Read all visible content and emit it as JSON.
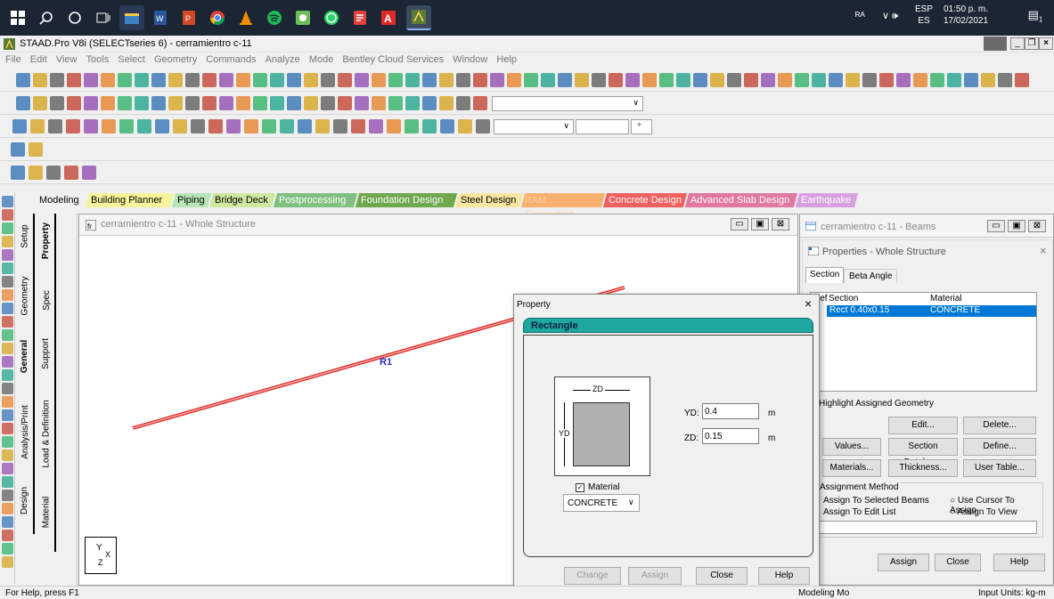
{
  "taskbar": {
    "lang_top": "ESP",
    "lang_bottom": "ES",
    "time": "01:50 p. m.",
    "date": "17/02/2021",
    "notification_count": "1",
    "icons": [
      "windows-icon",
      "search-icon",
      "cortana-icon",
      "task-view-icon",
      "file-explorer-icon",
      "word-icon",
      "powerpoint-icon",
      "chrome-icon",
      "vlc-icon",
      "spotify-icon",
      "app-green-icon",
      "whatsapp-icon",
      "app-red-icon",
      "acrobat-icon",
      "staad-icon"
    ]
  },
  "window": {
    "title": "STAAD.Pro V8i (SELECTseries 6) - cerramientro c-11"
  },
  "menu": [
    "File",
    "Edit",
    "View",
    "Tools",
    "Select",
    "Geometry",
    "Commands",
    "Analyze",
    "Mode",
    "Bentley Cloud Services",
    "Window",
    "Help"
  ],
  "ribbon_tabs": [
    {
      "label": "Modeling",
      "bg": "#f0f0f0",
      "fg": "#000000"
    },
    {
      "label": "Building Planner",
      "bg": "#f7f39a",
      "fg": "#000000"
    },
    {
      "label": "Piping",
      "bg": "#b8e6b8",
      "fg": "#000000"
    },
    {
      "label": "Bridge Deck",
      "bg": "#cfe8a0",
      "fg": "#000000"
    },
    {
      "label": "Postprocessing",
      "bg": "#80c080",
      "fg": "#ffffff"
    },
    {
      "label": "Foundation Design",
      "bg": "#6fa84f",
      "fg": "#ffffff"
    },
    {
      "label": "Steel Design",
      "bg": "#f7e6a0",
      "fg": "#000000"
    },
    {
      "label": "RAM Connection",
      "bg": "#f7b070",
      "fg": "#ffd0a0"
    },
    {
      "label": "Concrete Design",
      "bg": "#f06060",
      "fg": "#ffffff"
    },
    {
      "label": "Advanced Slab Design",
      "bg": "#e078a0",
      "fg": "#ffffff"
    },
    {
      "label": "Earthquake",
      "bg": "#d8a0e0",
      "fg": "#ffffff"
    }
  ],
  "side_tabs": {
    "outer": [
      "Setup",
      "Geometry",
      "General",
      "Analysis/Print",
      "Design"
    ],
    "inner": [
      "Property",
      "Spec",
      "Support",
      "Load & Definition",
      "Material"
    ]
  },
  "main_view": {
    "title": "cerramientro c-11 - Whole Structure",
    "beam_label": "R1",
    "axis_y": "Y",
    "axis_x": "X",
    "axis_z": "Z"
  },
  "beams_window": {
    "title": "cerramientro c-11 - Beams",
    "properties_title": "Properties - Whole Structure",
    "tabs": [
      "Section",
      "Beta Angle"
    ],
    "columns": [
      "Ref",
      "Section",
      "Material"
    ],
    "row": {
      "section": "Rect 0.40x0.15",
      "material": "CONCRETE"
    },
    "highlight_label": "Highlight Assigned Geometry",
    "buttons": {
      "edit": "Edit...",
      "delete": "Delete...",
      "values": "Values...",
      "section_database": "Section Database",
      "define": "Define...",
      "materials": "Materials...",
      "thickness": "Thickness...",
      "user_table": "User Table..."
    },
    "assignment_method_label": "Assignment Method",
    "options": {
      "selected": "Assign To Selected Beams",
      "edit_list": "Assign To Edit List",
      "cursor": "Use Cursor To Assign",
      "view": "Assign To View"
    },
    "footer_buttons": {
      "assign": "Assign",
      "close": "Close",
      "help": "Help"
    }
  },
  "dialog": {
    "title": "Property",
    "header": "Rectangle",
    "zd_dim": "ZD",
    "yd_dim": "YD",
    "yd_label": "YD:",
    "yd_value": "0.4",
    "yd_unit": "m",
    "zd_label": "ZD:",
    "zd_value": "0.15",
    "zd_unit": "m",
    "material_label": "Material",
    "material_value": "CONCRETE",
    "buttons": {
      "change": "Change",
      "assign": "Assign",
      "close": "Close",
      "help": "Help"
    }
  },
  "status": {
    "help": "For Help, press F1",
    "mode": "Modeling Mo",
    "units": "Input Units:  kg-m"
  },
  "colors": {
    "beam": "#e0302a",
    "selection": "#0078d7",
    "dialog_header": "#1fa8a0",
    "taskbar": "#1c2533"
  }
}
